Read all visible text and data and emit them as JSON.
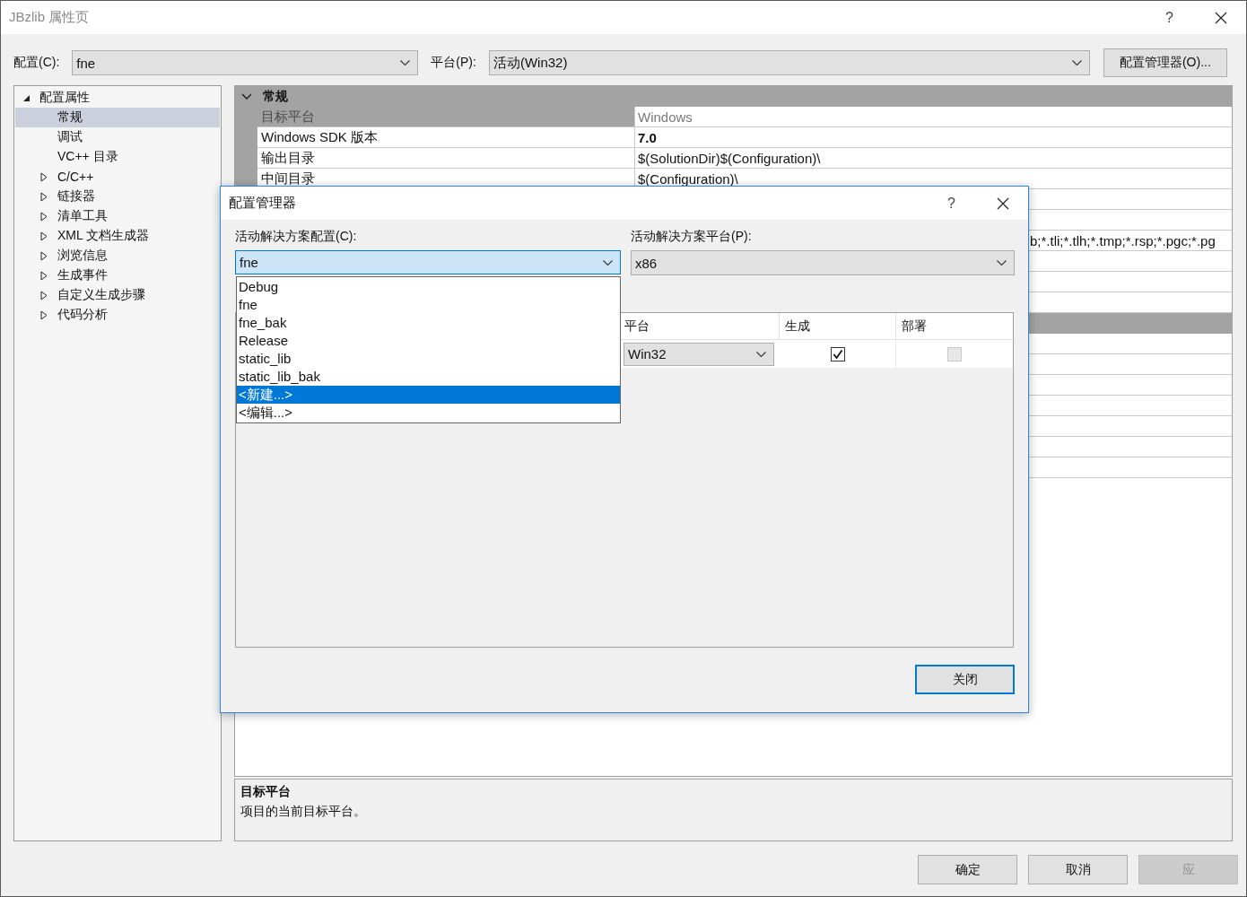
{
  "window": {
    "title": "JBzlib 属性页",
    "help": "?"
  },
  "toolbar": {
    "config_label": "配置(C):",
    "config_value": "fne",
    "platform_label": "平台(P):",
    "platform_value": "活动(Win32)",
    "manager_button": "配置管理器(O)..."
  },
  "tree": [
    {
      "label": "配置属性",
      "kind": "group",
      "expanded": true,
      "selected": false,
      "children": [
        {
          "label": "常规",
          "kind": "leaf",
          "selected": true
        },
        {
          "label": "调试",
          "kind": "leaf",
          "selected": false
        },
        {
          "label": "VC++ 目录",
          "kind": "leaf",
          "selected": false
        },
        {
          "label": "C/C++",
          "kind": "group",
          "expanded": false,
          "selected": false
        },
        {
          "label": "链接器",
          "kind": "group",
          "expanded": false,
          "selected": false
        },
        {
          "label": "清单工具",
          "kind": "group",
          "expanded": false,
          "selected": false
        },
        {
          "label": "XML 文档生成器",
          "kind": "group",
          "expanded": false,
          "selected": false
        },
        {
          "label": "浏览信息",
          "kind": "group",
          "expanded": false,
          "selected": false
        },
        {
          "label": "生成事件",
          "kind": "group",
          "expanded": false,
          "selected": false
        },
        {
          "label": "自定义生成步骤",
          "kind": "group",
          "expanded": false,
          "selected": false
        },
        {
          "label": "代码分析",
          "kind": "group",
          "expanded": false,
          "selected": false
        }
      ]
    }
  ],
  "property_grid": {
    "categories": [
      {
        "title": "常规",
        "expanded": true,
        "rows": [
          {
            "name": "目标平台",
            "value": "Windows",
            "selected": true,
            "disabled": true,
            "bold": false
          },
          {
            "name": "Windows SDK 版本",
            "value": "7.0",
            "selected": false,
            "disabled": false,
            "bold": true
          },
          {
            "name": "输出目录",
            "value": "$(SolutionDir)$(Configuration)\\",
            "selected": false,
            "disabled": false,
            "bold": false
          },
          {
            "name": "中间目录",
            "value": "$(Configuration)\\",
            "selected": false,
            "disabled": false,
            "bold": false
          },
          {
            "value": "b;*.tli;*.tlh;*.tmp;*.rsp;*.pgc;*.pg",
            "disabled": false,
            "bold": false,
            "value_start_covered": true
          }
        ]
      }
    ]
  },
  "description": {
    "title": "目标平台",
    "text": "项目的当前目标平台。"
  },
  "buttons": [
    {
      "label": "确定",
      "disabled": false
    },
    {
      "label": "取消",
      "disabled": false
    },
    {
      "label": "应",
      "disabled": true
    }
  ],
  "dialog": {
    "title": "配置管理器",
    "help": "?",
    "config_label": "活动解决方案配置(C):",
    "config_value": "fne",
    "platform_label": "活动解决方案平台(P):",
    "platform_value": "x86",
    "dropdown": [
      {
        "label": "Debug",
        "selected": false
      },
      {
        "label": "fne",
        "selected": false
      },
      {
        "label": "fne_bak",
        "selected": false
      },
      {
        "label": "Release",
        "selected": false
      },
      {
        "label": "static_lib",
        "selected": false
      },
      {
        "label": "static_lib_bak",
        "selected": false
      },
      {
        "label": "<新建...>",
        "selected": true
      },
      {
        "label": "<编辑...>",
        "selected": false
      }
    ],
    "columns": [
      "平台",
      "生成",
      "部署"
    ],
    "rows": [
      {
        "platform": "Win32",
        "build": {
          "checked": true,
          "disabled": false
        },
        "deploy": {
          "checked": false,
          "disabled": true
        }
      }
    ],
    "close_button": "关闭"
  }
}
